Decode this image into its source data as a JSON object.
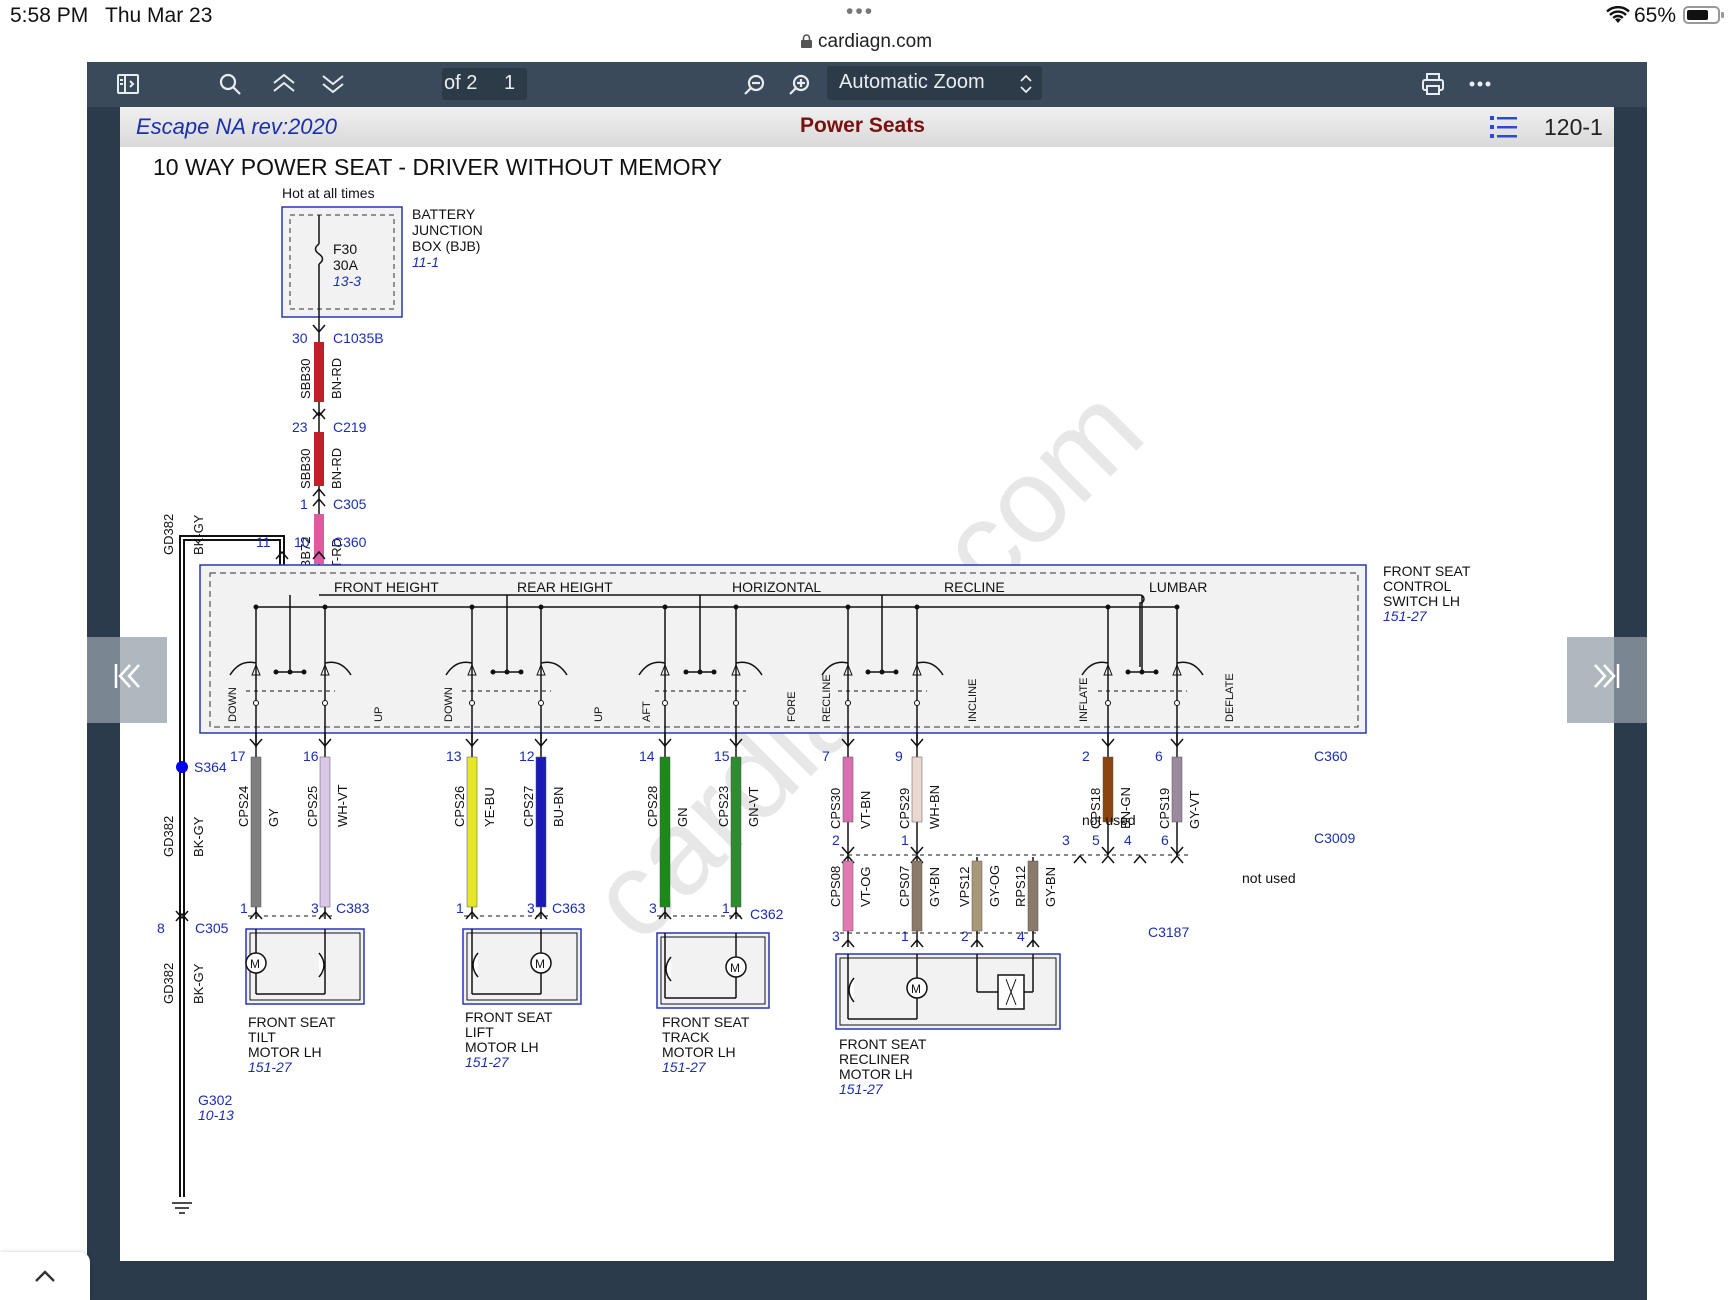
{
  "status": {
    "time": "5:58 PM",
    "date": "Thu Mar 23",
    "dots": "•••",
    "url": "cardiagn.com",
    "battery": "65%",
    "icons": [
      "wifi-icon",
      "battery-icon",
      "lock-icon"
    ]
  },
  "toolbar": {
    "page_number": "1",
    "page_total": "of 2",
    "zoom": "Automatic Zoom",
    "icons": [
      "sidebar-toggle-icon",
      "search-icon",
      "previous-page-icon",
      "next-page-icon",
      "zoom-out-icon",
      "zoom-in-icon",
      "print-icon",
      "more-icon"
    ]
  },
  "header": {
    "vehicle": "Escape NA rev:2020",
    "title": "Power Seats",
    "page_code": "120-1",
    "toc_icon": "list-icon"
  },
  "diagram": {
    "title": "10 WAY POWER SEAT - DRIVER WITHOUT MEMORY",
    "hot": "Hot at all times",
    "watermark": "cardiagn.com",
    "bjb": {
      "l1": "BATTERY",
      "l2": "JUNCTION",
      "l3": "BOX (BJB)",
      "ref": "11-1",
      "fuse": "F30",
      "amps": "30A",
      "fref": "13-3"
    },
    "feed": [
      {
        "pin": "30",
        "conn": "C1035B",
        "circuit": "SBB30",
        "color": "BN-RD"
      },
      {
        "pin": "23",
        "conn": "C219",
        "circuit": "SBB30",
        "color": "BN-RD"
      },
      {
        "pin": "1",
        "conn": "C305",
        "circuit": "SBB72",
        "color": "VT-RD"
      }
    ],
    "switch": {
      "l1": "FRONT SEAT",
      "l2": "CONTROL",
      "l3": "SWITCH LH",
      "ref": "151-27",
      "conn": "C360",
      "pin_gnd": "11",
      "pin_pwr": "10",
      "groups": [
        "FRONT HEIGHT",
        "REAR HEIGHT",
        "HORIZONTAL",
        "RECLINE",
        "LUMBAR"
      ],
      "positions": [
        "DOWN",
        "UP",
        "DOWN",
        "UP",
        "AFT",
        "FORE",
        "RECLINE",
        "INCLINE",
        "INFLATE",
        "DEFLATE"
      ]
    },
    "ground": {
      "circuit": "GD382",
      "color": "BK-GY",
      "splice": "S364",
      "pin": "8",
      "conn": "C305",
      "gnd": "G302",
      "ref": "10-13"
    },
    "wires": [
      {
        "pin": "17",
        "circuit": "CPS24",
        "color": "GY",
        "mpin": "1"
      },
      {
        "pin": "16",
        "circuit": "CPS25",
        "color": "WH-VT",
        "mpin": "3"
      },
      {
        "pin": "13",
        "circuit": "CPS26",
        "color": "YE-BU",
        "mpin": "1"
      },
      {
        "pin": "12",
        "circuit": "CPS27",
        "color": "BU-BN",
        "mpin": "3"
      },
      {
        "pin": "14",
        "circuit": "CPS28",
        "color": "GN",
        "mpin": "3"
      },
      {
        "pin": "15",
        "circuit": "CPS23",
        "color": "GN-VT",
        "mpin": "1"
      },
      {
        "pin": "7",
        "circuit": "CPS30",
        "color": "VT-BN",
        "mpin": "2"
      },
      {
        "pin": "9",
        "circuit": "CPS29",
        "color": "WH-BN",
        "mpin": "1"
      },
      {
        "pin": "2",
        "circuit": "CPS18",
        "color": "BN-GN",
        "mpin": "5"
      },
      {
        "pin": "6",
        "circuit": "CPS19",
        "color": "GY-VT",
        "mpin": "6"
      }
    ],
    "c360": "C360",
    "c3009": "C3009",
    "not_used_1": "not used",
    "not_used_2": "not used",
    "inline": {
      "p3": "3",
      "p4": "4"
    },
    "lower": [
      {
        "circuit": "CPS08",
        "color": "VT-OG",
        "pin": "3"
      },
      {
        "circuit": "CPS07",
        "color": "GY-BN",
        "pin": "1"
      },
      {
        "circuit": "VPS12",
        "color": "GY-OG",
        "pin": "2"
      },
      {
        "circuit": "RPS12",
        "color": "GY-BN",
        "pin": "4"
      }
    ],
    "c3187": "C3187",
    "motors": [
      {
        "l1": "FRONT SEAT",
        "l2": "TILT",
        "l3": "MOTOR LH",
        "ref": "151-27",
        "conn": "C383"
      },
      {
        "l1": "FRONT SEAT",
        "l2": "LIFT",
        "l3": "MOTOR LH",
        "ref": "151-27",
        "conn": "C363"
      },
      {
        "l1": "FRONT SEAT",
        "l2": "TRACK",
        "l3": "MOTOR LH",
        "ref": "151-27",
        "conn": "C362"
      },
      {
        "l1": "FRONT SEAT",
        "l2": "RECLINER",
        "l3": "MOTOR LH",
        "ref": "151-27",
        "conn": ""
      }
    ],
    "wire_colors": {
      "GY": "#7f7f7f",
      "WH-VT": "#d9c8e8",
      "YE-BU": "#e6e62a",
      "BU-BN": "#1a1ab8",
      "GN": "#1a8a1a",
      "GN-VT": "#2e8b2e",
      "VT-BN": "#d86fb0",
      "WH-BN": "#e8d8d0",
      "BN-GN": "#8b4513",
      "GY-VT": "#9a8aa0",
      "VT-OG": "#e07ab0",
      "GY-BN": "#8a7a6a",
      "GY-OG": "#a89878",
      "BN-RD": "#c0202a",
      "VT-RD": "#e05aa0",
      "BK-GY": "#111111"
    }
  }
}
